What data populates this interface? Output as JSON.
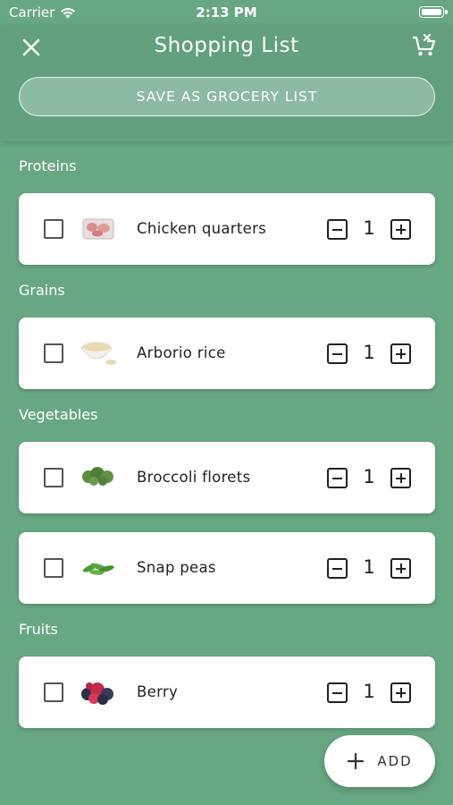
{
  "status_bar": {
    "carrier": "Carrier",
    "time": "2:13 PM"
  },
  "header": {
    "title": "Shopping List",
    "save_label": "SAVE AS GROCERY LIST"
  },
  "sections": [
    {
      "label": "Proteins",
      "items": [
        {
          "name": "Chicken quarters",
          "qty": "1",
          "icon": "chicken-image"
        }
      ]
    },
    {
      "label": "Grains",
      "items": [
        {
          "name": "Arborio rice",
          "qty": "1",
          "icon": "rice-image"
        }
      ]
    },
    {
      "label": "Vegetables",
      "items": [
        {
          "name": "Broccoli florets",
          "qty": "1",
          "icon": "broccoli-image"
        },
        {
          "name": "Snap peas",
          "qty": "1",
          "icon": "snap-peas-image"
        }
      ]
    },
    {
      "label": "Fruits",
      "items": [
        {
          "name": "Berry",
          "qty": "1",
          "icon": "berry-image"
        }
      ]
    }
  ],
  "fab": {
    "label": "ADD"
  },
  "colors": {
    "background": "#68a784",
    "card": "#ffffff"
  }
}
